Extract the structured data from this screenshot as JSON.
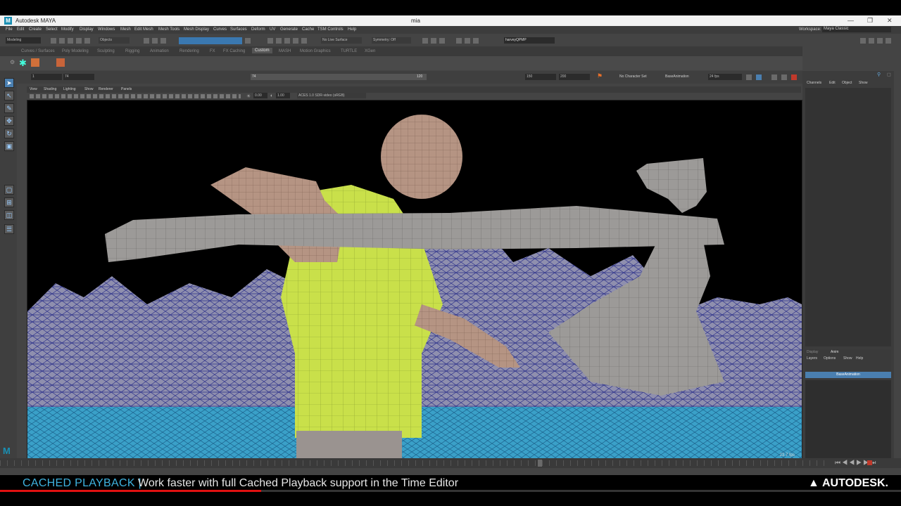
{
  "window": {
    "title": "Autodesk MAYA",
    "center_title": "mia",
    "logo_letter": "M",
    "controls": [
      "—",
      "❐",
      "✕"
    ]
  },
  "menus": [
    "File",
    "Edit",
    "Create",
    "Select",
    "Modify",
    "Display",
    "Windows",
    "Mesh",
    "Edit Mesh",
    "Mesh Tools",
    "Mesh Display",
    "Curves",
    "Surfaces",
    "Deform",
    "UV",
    "Generate",
    "Cache",
    "TSM Controls",
    "Help"
  ],
  "statusline": {
    "mode": "Modeling",
    "objects_label": "Objects",
    "live_surface": "No Live Surface",
    "symmetry": "Symmetry: Off",
    "user": "harveyQPMP",
    "workspace_label": "Workspace:",
    "workspace_value": "Maya Classic"
  },
  "shelf_tabs": [
    "Curves / Surfaces",
    "Poly Modeling",
    "Sculpting",
    "Rigging",
    "Animation",
    "Rendering",
    "FX",
    "FX Caching",
    "Custom",
    "MASH",
    "Motion Graphics",
    "TURTLE",
    "XGen"
  ],
  "active_shelf_tab": "Custom",
  "time": {
    "start": "1",
    "current": "74",
    "slider_value": "74",
    "slider_end": "120",
    "range_end": "150",
    "anim_end": "200",
    "character_set": "No Character Set",
    "anim_layer": "BaseAnimation",
    "fps": "24 fps"
  },
  "viewport": {
    "menus": [
      "View",
      "Shading",
      "Lighting",
      "Show",
      "Renderer",
      "Panels"
    ],
    "exposure": "0.00",
    "gamma": "1.00",
    "color_space": "ACES 1.0 SDR-video (sRGB)",
    "fps_readout": "23.7 fps"
  },
  "channel_box": {
    "menus": [
      "Channels",
      "Edit",
      "Object",
      "Show"
    ]
  },
  "layer_editor": {
    "tabs": [
      "Display",
      "Anim"
    ],
    "menus": [
      "Layers",
      "Options",
      "Show",
      "Help"
    ],
    "layer": "BaseAnimation"
  },
  "caption": {
    "prefix": "CACHED PLAYBACK |",
    "text": "Work faster with full Cached Playback support in the Time Editor",
    "brand": "AUTODESK."
  },
  "video_progress": 0.29,
  "colors": {
    "accent": "#3fb3e0",
    "progress": "#e01010",
    "shirt": "#c9e04a",
    "wire": "#2a2f8a"
  }
}
